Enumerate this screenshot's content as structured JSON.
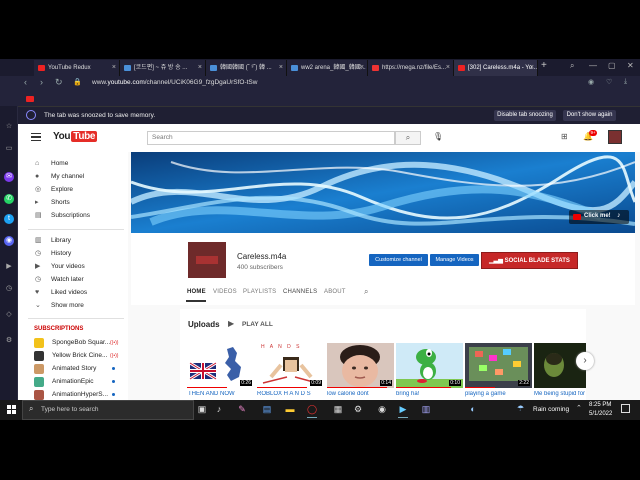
{
  "browser": {
    "tabs": [
      {
        "label": "YouTube Redux",
        "color": "#e22"
      },
      {
        "label": "[코드편] ~ 쥬 방 송 ...",
        "color": "#4a90d9"
      },
      {
        "label": "韓國韓國 (˘ ³˘) 韓 ...",
        "color": "#4a90d9"
      },
      {
        "label": "ww2 arena_韓國_韓國...",
        "color": "#4a90d9"
      },
      {
        "label": "https://mega.nz/file/Es...",
        "color": "#e33"
      },
      {
        "label": "[302] Careless.m4a - Yo...",
        "color": "#e22"
      }
    ],
    "new_tab": "+",
    "url_prefix": "www.",
    "url_host": "youtube.com",
    "url_path": "/channel/UCiK06G9_fzgDgaUrSfO-tSw",
    "snooze_message": "The tab was snoozed to save memory.",
    "snooze_disable": "Disable tab snoozing",
    "snooze_dont_show": "Don't show again"
  },
  "youtube": {
    "logo_you": "You",
    "logo_tube": "Tube",
    "search_placeholder": "Search",
    "notification_count": "9+",
    "nav": [
      {
        "label": "Home",
        "icon": "⌂"
      },
      {
        "label": "My channel",
        "icon": "●"
      },
      {
        "label": "Explore",
        "icon": "◎"
      },
      {
        "label": "Shorts",
        "icon": "▸"
      },
      {
        "label": "Subscriptions",
        "icon": "▤"
      }
    ],
    "nav2": [
      {
        "label": "Library",
        "icon": "▥"
      },
      {
        "label": "History",
        "icon": "◷"
      },
      {
        "label": "Your videos",
        "icon": "▶"
      },
      {
        "label": "Watch later",
        "icon": "◷"
      },
      {
        "label": "Liked videos",
        "icon": "♥"
      },
      {
        "label": "Show more",
        "icon": "⌄"
      }
    ],
    "subscriptions_heading": "SUBSCRIPTIONS",
    "subscriptions": [
      {
        "label": "SpongeBob Squar...",
        "marker": "live",
        "color": "#f2c21b"
      },
      {
        "label": "Yellow Brick Cine...",
        "marker": "live",
        "color": "#333"
      },
      {
        "label": "Animated Story",
        "marker": "dot",
        "color": "#c96"
      },
      {
        "label": "AnimationEpic",
        "marker": "dot",
        "color": "#4a8"
      },
      {
        "label": "AnimationHyperS...",
        "marker": "dot",
        "color": "#a54"
      }
    ],
    "banner_click": "Click me!",
    "channel_name": "Careless.m4a",
    "channel_subs": "400 subscribers",
    "customize_channel": "Customize channel",
    "manage_videos": "Manage Videos",
    "social_blade": "SOCIAL BLADE STATS",
    "channel_tabs": [
      "HOME",
      "VIDEOS",
      "PLAYLISTS",
      "CHANNELS",
      "ABOUT"
    ],
    "uploads_title": "Uploads",
    "play_all": "PLAY ALL",
    "videos": [
      {
        "title": "THEN AND NOW",
        "duration": "0:26",
        "thumb": "flag"
      },
      {
        "title": "ROBLOX H A N D S",
        "duration": "0:09",
        "thumb": "roblox",
        "banner": "H A N D S"
      },
      {
        "title": "low calorie dont",
        "duration": "0:14",
        "thumb": "face"
      },
      {
        "title": "bring ha!",
        "duration": "0:10",
        "thumb": "yoshi"
      },
      {
        "title": "playing a game",
        "duration": "2:22",
        "thumb": "game"
      },
      {
        "title": "Me being stupid for",
        "duration": "",
        "thumb": "dark"
      }
    ]
  },
  "taskbar": {
    "search_placeholder": "Type here to search",
    "weather": "Rain coming",
    "time": "8:25 PM",
    "date": "5/1/2022"
  }
}
